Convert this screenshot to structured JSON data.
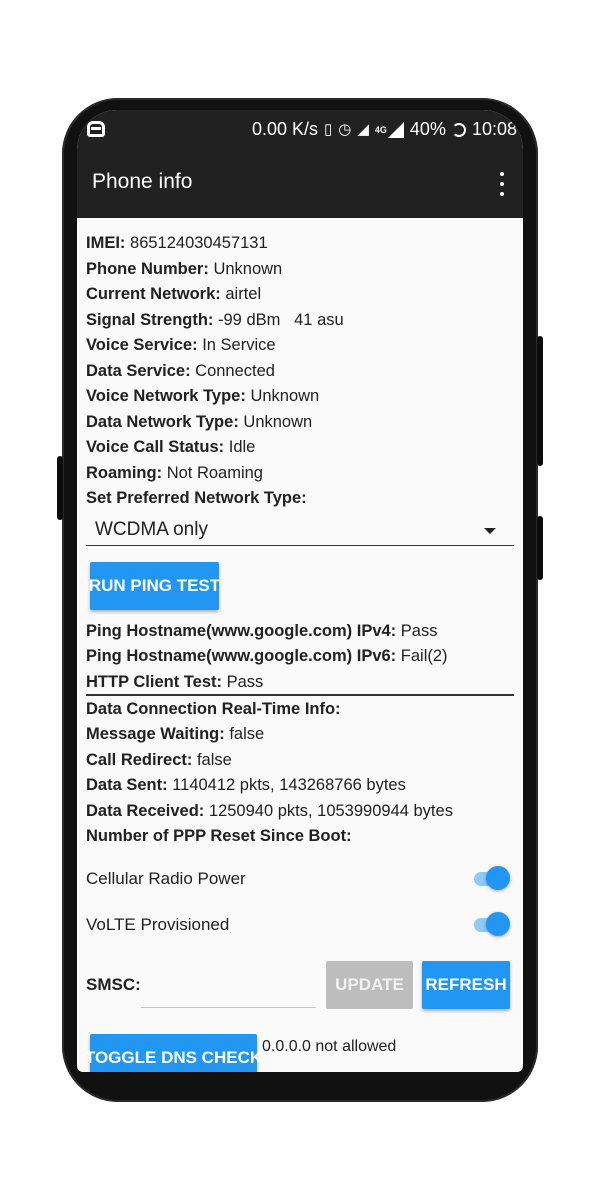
{
  "statusbar": {
    "speed": "0.00 K/s",
    "network_badge": "4G",
    "battery": "40%",
    "time": "10:08",
    "icons": [
      "notification-icon",
      "vibrate-icon",
      "alarm-icon",
      "no-sim-icon",
      "signal-icon",
      "battery-icon"
    ]
  },
  "appbar": {
    "title": "Phone info",
    "menu_icon": "more-vert-icon"
  },
  "info": {
    "imei": {
      "label": "IMEI:",
      "value": "865124030457131"
    },
    "phone_number": {
      "label": "Phone Number:",
      "value": "Unknown"
    },
    "current_network": {
      "label": "Current Network:",
      "value": "airtel"
    },
    "signal_strength": {
      "label": "Signal Strength:",
      "value": "-99 dBm   41 asu"
    },
    "voice_service": {
      "label": "Voice Service:",
      "value": "In Service"
    },
    "data_service": {
      "label": "Data Service:",
      "value": "Connected"
    },
    "voice_network_type": {
      "label": "Voice Network Type:",
      "value": "Unknown"
    },
    "data_network_type": {
      "label": "Data Network Type:",
      "value": "Unknown"
    },
    "voice_call_status": {
      "label": "Voice Call Status:",
      "value": "Idle"
    },
    "roaming": {
      "label": "Roaming:",
      "value": "Not Roaming"
    },
    "preferred_network_label": "Set Preferred Network Type:"
  },
  "preferred_network": {
    "selected": "WCDMA only"
  },
  "ping": {
    "button": "RUN PING TEST",
    "ipv4": {
      "label": "Ping Hostname(www.google.com) IPv4:",
      "value": "Pass"
    },
    "ipv6": {
      "label": "Ping Hostname(www.google.com) IPv6:",
      "value": "Fail(2)"
    },
    "http": {
      "label": "HTTP Client Test:",
      "value": "Pass"
    }
  },
  "connection": {
    "realtime_label": "Data Connection Real-Time Info:",
    "message_waiting": {
      "label": "Message Waiting:",
      "value": "false"
    },
    "call_redirect": {
      "label": "Call Redirect:",
      "value": "false"
    },
    "data_sent": {
      "label": "Data Sent:",
      "value": "1140412 pkts, 143268766 bytes"
    },
    "data_received": {
      "label": "Data Received:",
      "value": "1250940 pkts, 1053990944 bytes"
    },
    "ppp_reset_label": "Number of PPP Reset Since Boot:"
  },
  "toggles": {
    "cellular_radio_power": {
      "label": "Cellular Radio Power",
      "on": true
    },
    "volte_provisioned": {
      "label": "VoLTE Provisioned",
      "on": true
    }
  },
  "smsc": {
    "label": "SMSC:",
    "value": "",
    "update_button": "UPDATE",
    "refresh_button": "REFRESH"
  },
  "dns": {
    "button": "TOGGLE DNS CHECK",
    "result": "0.0.0.0 not allowed"
  },
  "colors": {
    "accent": "#2196f3",
    "appbar": "#212121",
    "background": "#fafafa",
    "disabled": "#bdbdbd"
  }
}
